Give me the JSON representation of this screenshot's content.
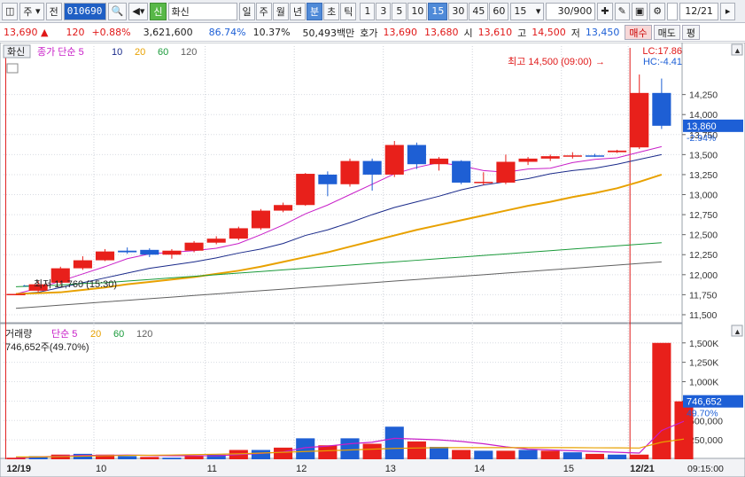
{
  "toolbar": {
    "jusik": "주",
    "jeon": "전",
    "code": "010690",
    "shin_badge": "신",
    "stock_name": "화신",
    "periods": [
      "일",
      "주",
      "월",
      "년",
      "분",
      "초",
      "틱"
    ],
    "period_selected": "분",
    "intervals": [
      "1",
      "3",
      "5",
      "10",
      "15",
      "30",
      "45",
      "60"
    ],
    "interval_selected": "15",
    "interval_value": "15",
    "count": "30/900",
    "date": "12/21"
  },
  "quote": {
    "price": "13,690",
    "change": "120",
    "change_pct": "+0.88%",
    "volume": "3,621,600",
    "ratio1": "86.74%",
    "ratio2": "10.37%",
    "amount": "50,493백만",
    "hoga_label": "호가",
    "hoga1": "13,690",
    "hoga2": "13,680",
    "open_label": "시",
    "open": "13,610",
    "high_label": "고",
    "high": "14,500",
    "low_label": "저",
    "low": "13,450",
    "buy_label": "매수",
    "sell_label": "매도",
    "more_label": "평"
  },
  "colors": {
    "up": "#e8201b",
    "down": "#1e5fd4",
    "ma5": "#c81ec8",
    "ma10": "#1a2a8a",
    "ma20": "#e8a100",
    "ma60": "#1a9a3a",
    "ma120": "#606060"
  },
  "chart_data": [
    {
      "type": "candlestick",
      "panel_label": "화신",
      "legend": [
        {
          "name": "종가 단순 5"
        },
        {
          "name": "10"
        },
        {
          "name": "20"
        },
        {
          "name": "60"
        },
        {
          "name": "120"
        }
      ],
      "ylim": [
        11400,
        14700
      ],
      "y_ticks": [
        11500,
        11750,
        12000,
        12250,
        12500,
        12750,
        13000,
        13250,
        13500,
        13750,
        14000,
        14250
      ],
      "y_tick_labels": [
        "11,500",
        "11,750",
        "12,000",
        "12,250",
        "12,500",
        "12,750",
        "13,000",
        "13,250",
        "13,500",
        "13,750",
        "14,000",
        "14,250"
      ],
      "x_labels": [
        "12/19",
        "10",
        "11",
        "12",
        "13",
        "14",
        "15",
        "12/21"
      ],
      "candles": [
        {
          "o": 11760,
          "h": 11760,
          "l": 11760,
          "c": 11760
        },
        {
          "o": 11800,
          "h": 11920,
          "l": 11780,
          "c": 11880
        },
        {
          "o": 11900,
          "h": 12100,
          "l": 11880,
          "c": 12080
        },
        {
          "o": 12080,
          "h": 12230,
          "l": 12060,
          "c": 12180
        },
        {
          "o": 12180,
          "h": 12320,
          "l": 12170,
          "c": 12290
        },
        {
          "o": 12300,
          "h": 12340,
          "l": 12260,
          "c": 12280
        },
        {
          "o": 12310,
          "h": 12330,
          "l": 12220,
          "c": 12250
        },
        {
          "o": 12250,
          "h": 12320,
          "l": 12200,
          "c": 12300
        },
        {
          "o": 12300,
          "h": 12420,
          "l": 12280,
          "c": 12400
        },
        {
          "o": 12400,
          "h": 12480,
          "l": 12380,
          "c": 12450
        },
        {
          "o": 12450,
          "h": 12600,
          "l": 12430,
          "c": 12580
        },
        {
          "o": 12580,
          "h": 12820,
          "l": 12560,
          "c": 12800
        },
        {
          "o": 12800,
          "h": 12900,
          "l": 12780,
          "c": 12870
        },
        {
          "o": 12870,
          "h": 13270,
          "l": 12860,
          "c": 13260
        },
        {
          "o": 13250,
          "h": 13290,
          "l": 12980,
          "c": 13130
        },
        {
          "o": 13130,
          "h": 13450,
          "l": 13100,
          "c": 13420
        },
        {
          "o": 13420,
          "h": 13450,
          "l": 13050,
          "c": 13250
        },
        {
          "o": 13250,
          "h": 13670,
          "l": 13220,
          "c": 13620
        },
        {
          "o": 13620,
          "h": 13650,
          "l": 13320,
          "c": 13380
        },
        {
          "o": 13380,
          "h": 13470,
          "l": 13300,
          "c": 13450
        },
        {
          "o": 13420,
          "h": 13430,
          "l": 13130,
          "c": 13150
        },
        {
          "o": 13150,
          "h": 13280,
          "l": 13120,
          "c": 13160
        },
        {
          "o": 13150,
          "h": 13500,
          "l": 13130,
          "c": 13410
        },
        {
          "o": 13410,
          "h": 13470,
          "l": 13370,
          "c": 13450
        },
        {
          "o": 13450,
          "h": 13500,
          "l": 13420,
          "c": 13480
        },
        {
          "o": 13480,
          "h": 13530,
          "l": 13450,
          "c": 13490
        },
        {
          "o": 13490,
          "h": 13510,
          "l": 13470,
          "c": 13480
        },
        {
          "o": 13530,
          "h": 13560,
          "l": 13520,
          "c": 13550
        },
        {
          "o": 13590,
          "h": 14500,
          "l": 13570,
          "c": 14270
        },
        {
          "o": 14270,
          "h": 14450,
          "l": 13820,
          "c": 13860
        }
      ],
      "ma": {
        "ma5": [
          11760,
          11830,
          11920,
          12010,
          12100,
          12200,
          12260,
          12280,
          12300,
          12330,
          12390,
          12500,
          12620,
          12760,
          12870,
          13000,
          13130,
          13260,
          13340,
          13400,
          13360,
          13300,
          13280,
          13320,
          13330,
          13400,
          13440,
          13460,
          13530,
          13600
        ],
        "ma10": [
          11760,
          11780,
          11840,
          11900,
          11960,
          12020,
          12080,
          12120,
          12160,
          12210,
          12270,
          12320,
          12390,
          12490,
          12560,
          12650,
          12750,
          12840,
          12910,
          12980,
          13060,
          13120,
          13160,
          13200,
          13260,
          13300,
          13330,
          13380,
          13440,
          13500
        ],
        "ma20": [
          11760,
          11770,
          11780,
          11810,
          11840,
          11880,
          11910,
          11940,
          11970,
          12010,
          12050,
          12100,
          12160,
          12220,
          12280,
          12350,
          12420,
          12490,
          12560,
          12620,
          12680,
          12740,
          12800,
          12860,
          12910,
          12970,
          13020,
          13080,
          13160,
          13250
        ],
        "ma60": [
          11850,
          11860,
          11870,
          11890,
          11900,
          11920,
          11940,
          11960,
          11980,
          12000,
          12020,
          12040,
          12060,
          12080,
          12100,
          12120,
          12140,
          12160,
          12180,
          12200,
          12220,
          12240,
          12260,
          12280,
          12300,
          12320,
          12340,
          12360,
          12380,
          12400
        ],
        "ma120": [
          11580,
          11600,
          11620,
          11640,
          11660,
          11680,
          11700,
          11720,
          11740,
          11760,
          11780,
          11800,
          11820,
          11840,
          11860,
          11880,
          11900,
          11920,
          11940,
          11960,
          11980,
          12000,
          12020,
          12040,
          12060,
          12080,
          12100,
          12120,
          12140,
          12160
        ]
      },
      "lc_label": "LC:17.86",
      "hc_label": "HC:-4.41",
      "high_note": "최고 14,500 (09:00)",
      "low_note": "최저 11,760 (15:30)",
      "current_price": "13,860",
      "current_pct": "-2.94%"
    },
    {
      "type": "bar",
      "panel_label": "거래량",
      "legend": [
        {
          "name": "단순 5"
        },
        {
          "name": "20"
        },
        {
          "name": "60"
        },
        {
          "name": "120"
        }
      ],
      "info": "746,652주(49.70%)",
      "ylim": [
        0,
        1600000
      ],
      "y_ticks": [
        250000,
        500000,
        750000,
        1000000,
        1250000,
        1500000
      ],
      "y_tick_labels": [
        "250,000",
        "500,000",
        "750K",
        "1,000K",
        "1,250K",
        "1,500K"
      ],
      "x_labels": [
        "12/19",
        "10",
        "11",
        "12",
        "13",
        "14",
        "15",
        "12/21"
      ],
      "time_label": "09:15:00",
      "values": [
        20000,
        40000,
        60000,
        70000,
        60000,
        40000,
        30000,
        20000,
        50000,
        60000,
        120000,
        120000,
        150000,
        270000,
        180000,
        270000,
        200000,
        420000,
        230000,
        160000,
        120000,
        110000,
        110000,
        120000,
        110000,
        90000,
        70000,
        60000,
        60000,
        1500000,
        746652
      ],
      "ma5": [
        20000,
        30000,
        40000,
        50000,
        50000,
        55000,
        50000,
        45000,
        45000,
        45000,
        60000,
        75000,
        95000,
        150000,
        170000,
        200000,
        220000,
        270000,
        260000,
        250000,
        230000,
        200000,
        160000,
        130000,
        120000,
        110000,
        100000,
        90000,
        80000,
        370000,
        490000
      ],
      "ma20": [
        30000,
        30000,
        35000,
        40000,
        45000,
        50000,
        52000,
        55000,
        60000,
        65000,
        70000,
        80000,
        90000,
        100000,
        110000,
        120000,
        130000,
        140000,
        145000,
        150000,
        150000,
        150000,
        150000,
        150000,
        150000,
        150000,
        148000,
        147000,
        145000,
        220000,
        260000
      ]
    }
  ]
}
